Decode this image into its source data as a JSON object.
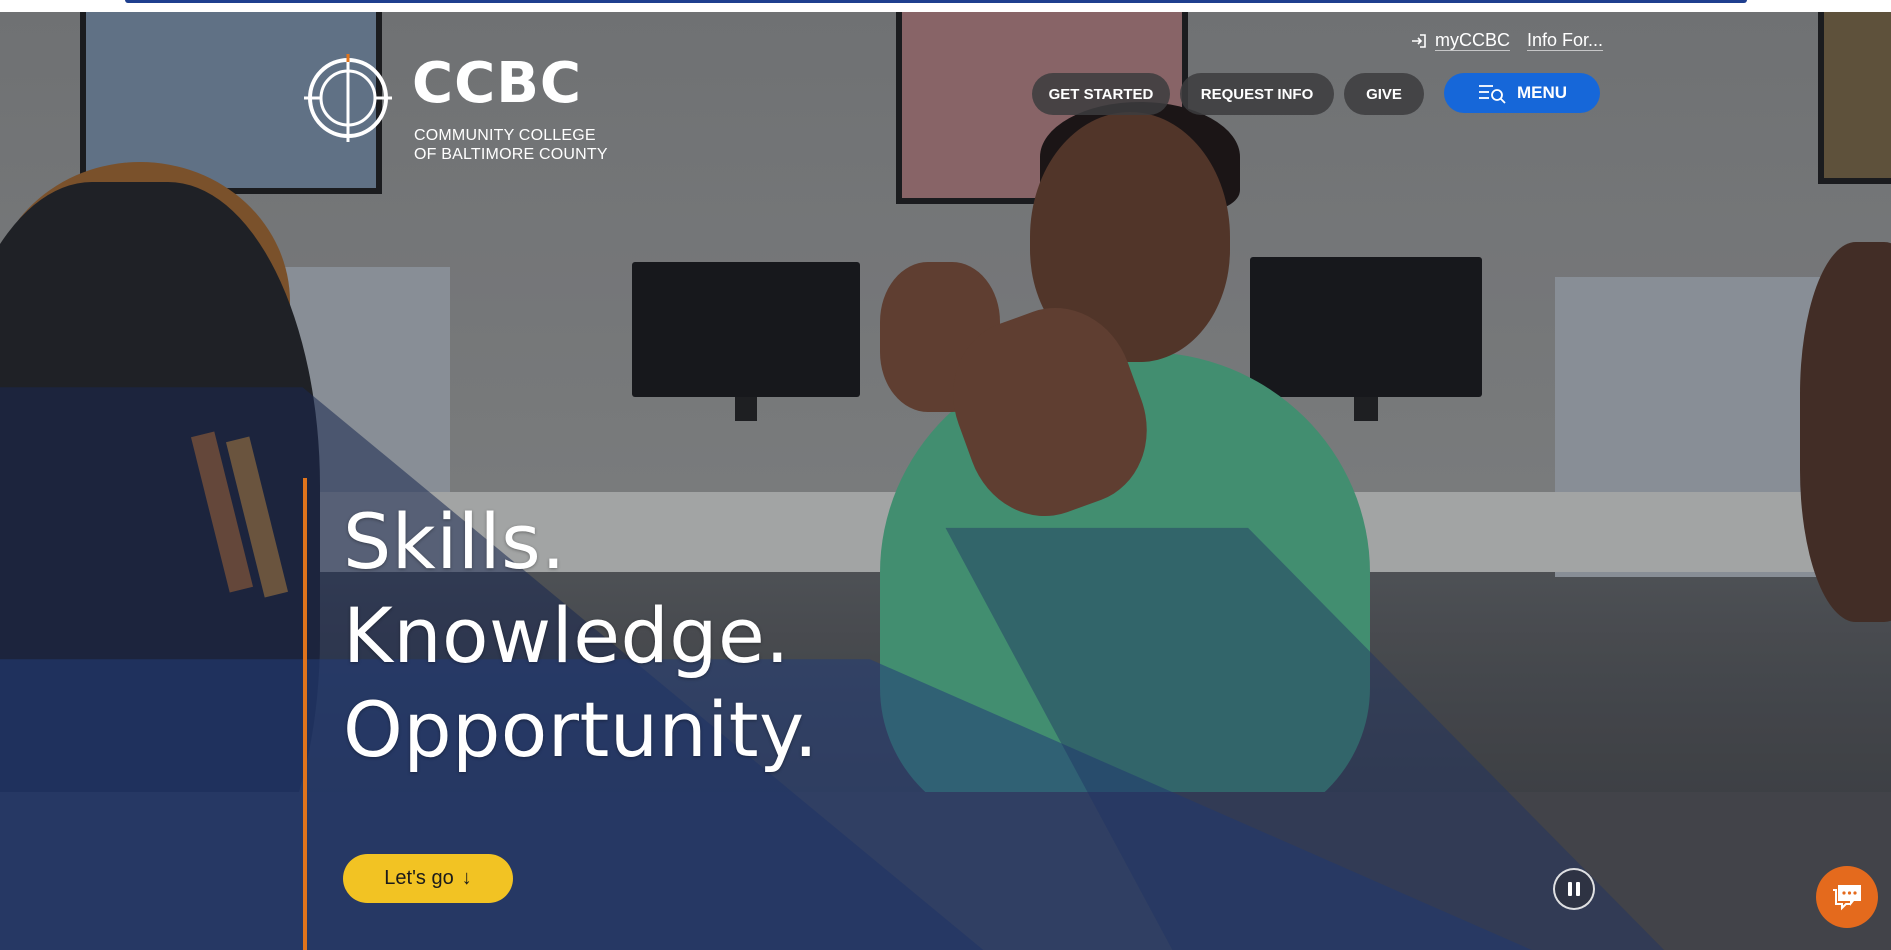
{
  "brand": {
    "name": "CCBC",
    "subtitle_line1": "COMMUNITY COLLEGE",
    "subtitle_line2": "OF BALTIMORE COUNTY"
  },
  "utility_nav": {
    "my_ccbc": "myCCBC",
    "info_for": "Info For..."
  },
  "main_nav": {
    "get_started": "GET STARTED",
    "request_info": "REQUEST INFO",
    "give": "GIVE",
    "menu": "MENU"
  },
  "hero": {
    "headline_line1": "Skills.",
    "headline_line2": "Knowledge.",
    "headline_line3": "Opportunity.",
    "cta_label": "Let's go",
    "cta_arrow": "↓"
  },
  "icons": {
    "login": "login-icon",
    "menu_search": "menu-search-icon",
    "pause": "pause-icon",
    "chat": "chat-icon",
    "arrow": "arrow-down-icon"
  },
  "colors": {
    "menu_button": "#1667d9",
    "cta_button": "#f2c323",
    "accent_line": "#e0741c",
    "chat_button": "#e46a1d"
  }
}
